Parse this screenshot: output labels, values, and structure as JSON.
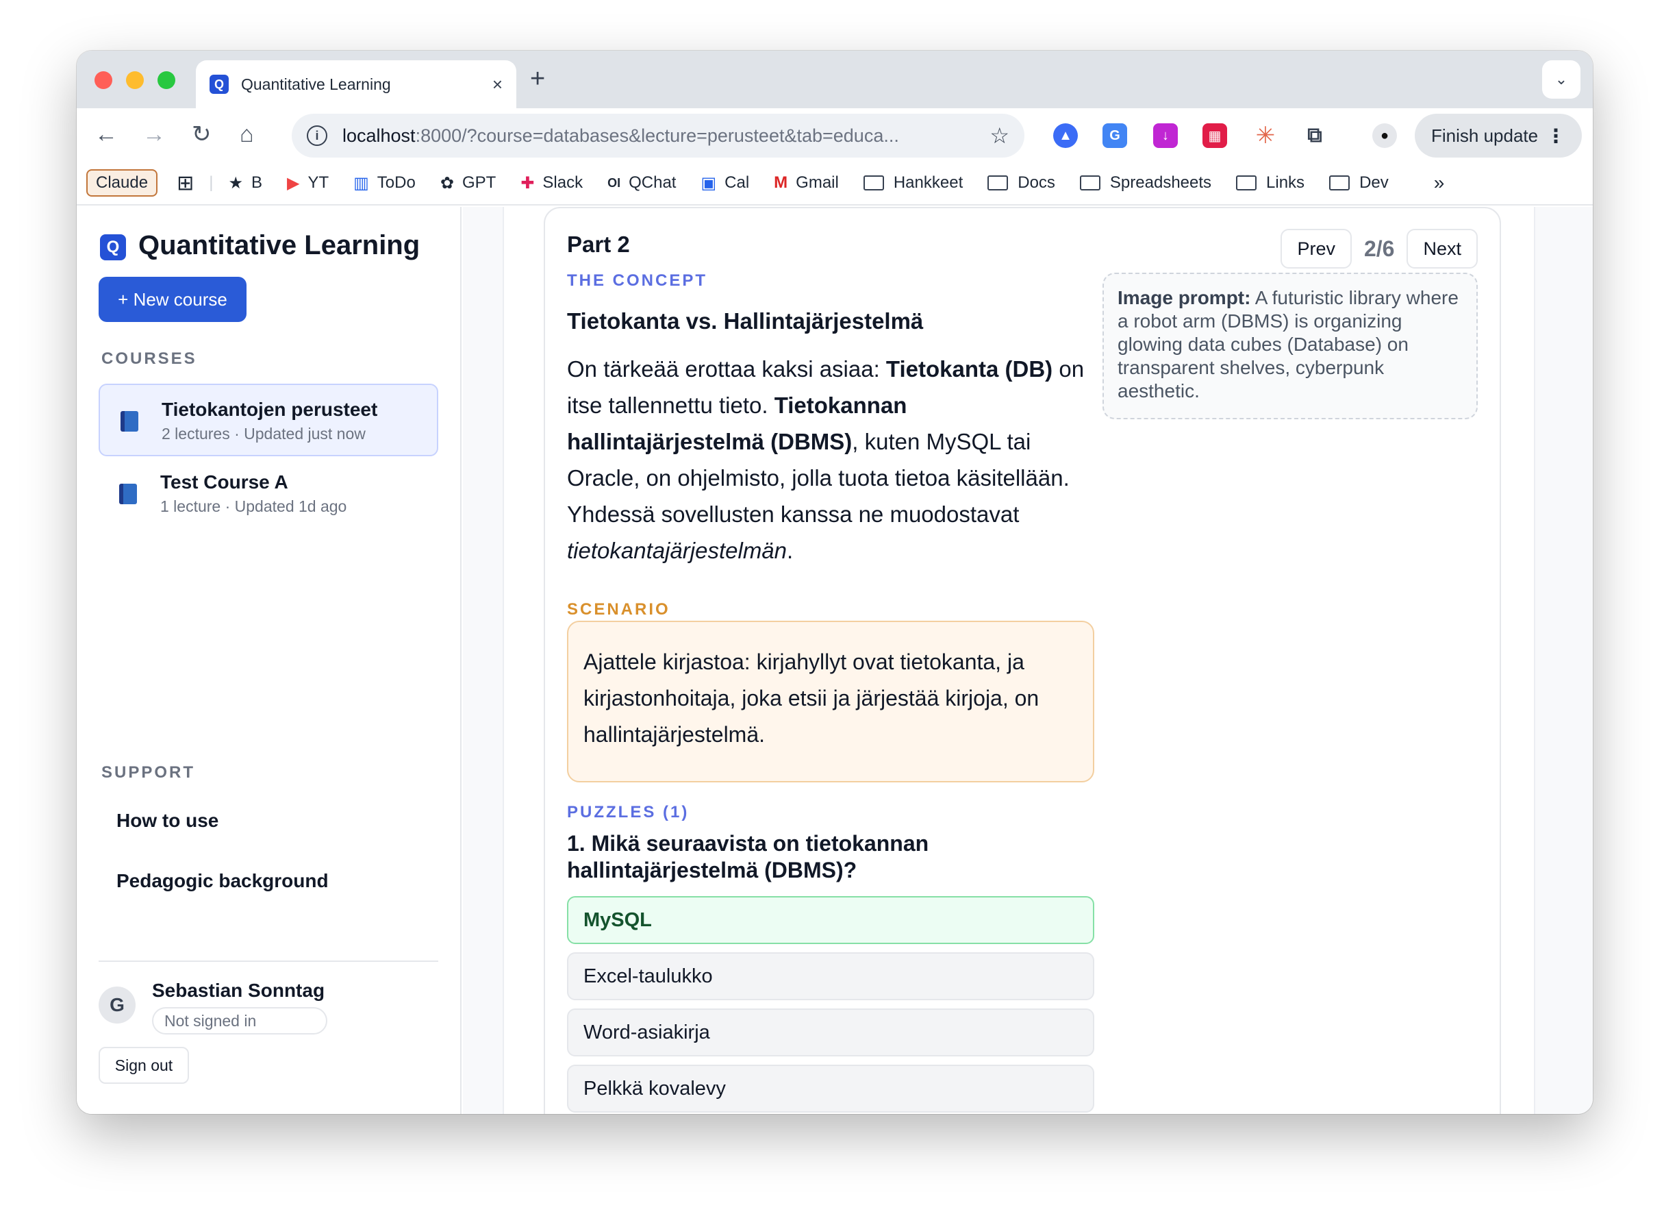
{
  "browser": {
    "tab_title": "Quantitative Learning",
    "tab_close": "×",
    "new_tab": "+",
    "url_host": "localhost",
    "url_rest": ":8000/?course=databases&lecture=perusteet&tab=educa...",
    "finish_update": "Finish update",
    "bookmarks": [
      {
        "label": "Claude",
        "icon": "claude-chip"
      },
      {
        "label": "B",
        "icon": "star-icon"
      },
      {
        "label": "YT",
        "icon": "youtube-icon"
      },
      {
        "label": "ToDo",
        "icon": "trello-icon"
      },
      {
        "label": "GPT",
        "icon": "openai-icon"
      },
      {
        "label": "Slack",
        "icon": "slack-icon"
      },
      {
        "label": "QChat",
        "icon": "qchat-icon"
      },
      {
        "label": "Cal",
        "icon": "calendar-icon"
      },
      {
        "label": "Gmail",
        "icon": "gmail-icon"
      },
      {
        "label": "Hankkeet",
        "icon": "folder-icon"
      },
      {
        "label": "Docs",
        "icon": "folder-icon"
      },
      {
        "label": "Spreadsheets",
        "icon": "folder-icon"
      },
      {
        "label": "Links",
        "icon": "folder-icon"
      },
      {
        "label": "Dev",
        "icon": "folder-icon"
      }
    ]
  },
  "sidebar": {
    "app_title": "Quantitative Learning",
    "new_course": "+ New course",
    "courses_label": "COURSES",
    "courses": [
      {
        "name": "Tietokantojen perusteet",
        "meta": "2 lectures · Updated just now"
      },
      {
        "name": "Test Course A",
        "meta": "1 lecture · Updated 1d ago"
      }
    ],
    "support_label": "SUPPORT",
    "support_links": [
      "How to use",
      "Pedagogic background"
    ],
    "user": {
      "initial": "G",
      "name": "Sebastian Sonntag",
      "status": "Not signed in"
    },
    "sign_out": "Sign out"
  },
  "main": {
    "part_title": "Part 2",
    "pager": {
      "prev": "Prev",
      "count": "2/6",
      "next": "Next"
    },
    "concept_label": "THE CONCEPT",
    "concept_title": "Tietokanta vs. Hallintajärjestelmä",
    "concept_body": {
      "t1": "On tärkeää erottaa kaksi asiaa: ",
      "b1": "Tietokanta (DB)",
      "t2": " on itse tallennettu tieto. ",
      "b2": "Tietokannan hallintajärjestelmä (DBMS)",
      "t3": ", kuten MySQL tai Oracle, on ohjelmisto, jolla tuota tietoa käsitellään. Yhdessä sovellusten kanssa ne muodostavat ",
      "i1": "tietokantajärjestelmän",
      "t4": "."
    },
    "image_prompt": {
      "label": "Image prompt:",
      "text": " A futuristic library where a robot arm (DBMS) is organizing glowing data cubes (Database) on transparent shelves, cyberpunk aesthetic."
    },
    "scenario_label": "SCENARIO",
    "scenario_text": "Ajattele kirjastoa: kirjahyllyt ovat tietokanta, ja kirjastonhoitaja, joka etsii ja järjestää kirjoja, on hallintajärjestelmä.",
    "puzzles_label": "PUZZLES (1)",
    "question": "1. Mikä seuraavista on tietokannan hallintajärjestelmä (DBMS)?",
    "options": [
      "MySQL",
      "Excel-taulukko",
      "Word-asiakirja",
      "Pelkkä kovalevy"
    ]
  }
}
